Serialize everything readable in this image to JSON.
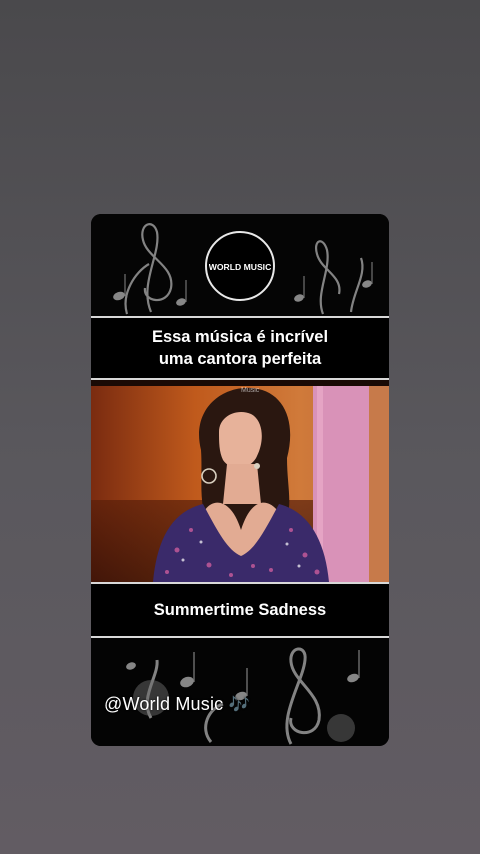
{
  "logo": {
    "text": "WORLD MUSIC",
    "icon": "world-music-logo-icon"
  },
  "caption": {
    "line1": "Essa música é incrível",
    "line2": "uma cantora perfeita"
  },
  "video": {
    "watermark": "Music"
  },
  "song_title": "Summertime Sadness",
  "handle": "@World Music",
  "handle_icon": "🎶",
  "colors": {
    "page_bg_top": "#4a494c",
    "page_bg_bottom": "#625c63",
    "card_bg": "#050505",
    "text": "#ffffff",
    "divider": "#d8d8d8",
    "note_icon": "#6fb7ff"
  }
}
